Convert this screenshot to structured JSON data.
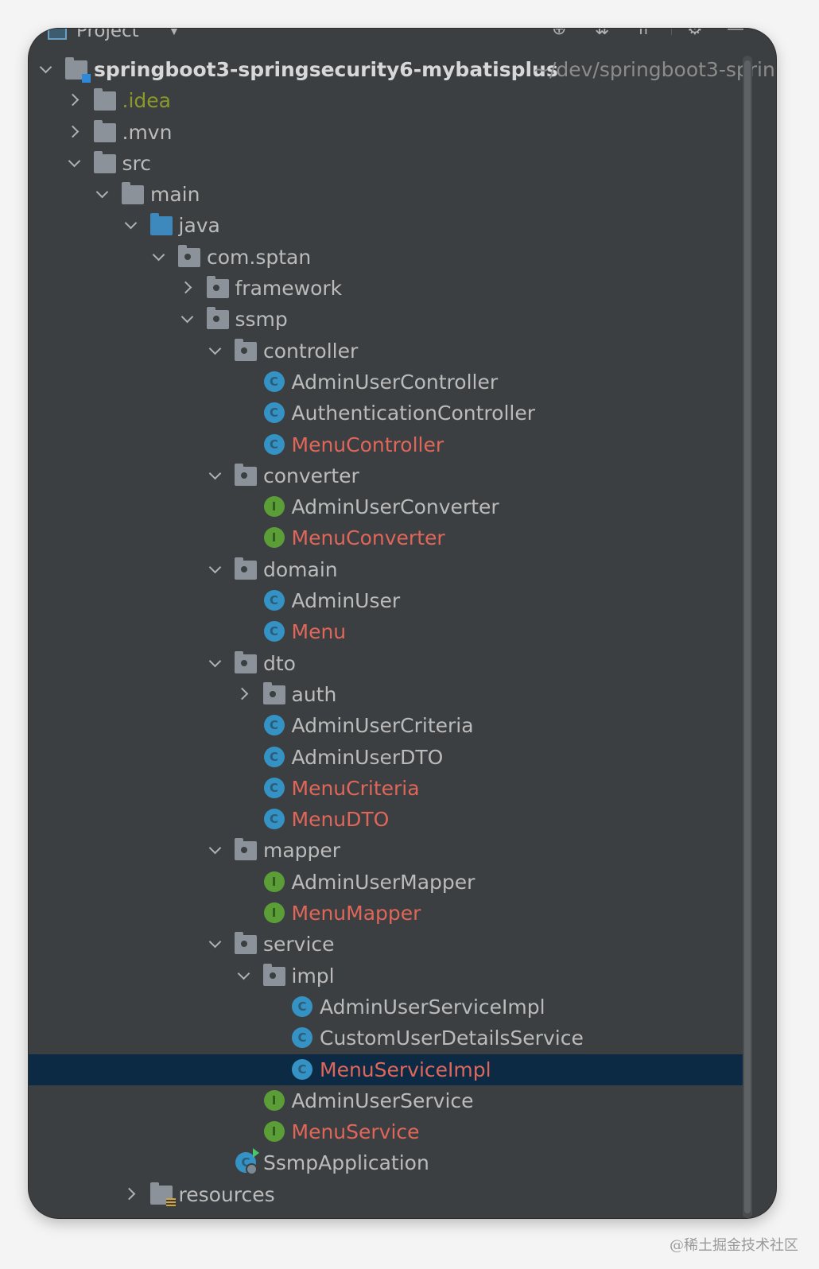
{
  "header": {
    "title": "Project",
    "caret_icon": "triangle-down-icon",
    "toolbar": [
      "crosshair-icon",
      "expand-all-icon",
      "collapse-all-icon",
      "gear-icon",
      "minimize-icon"
    ]
  },
  "tree": [
    {
      "depth": 0,
      "state": "expanded",
      "icon": "module-folder",
      "label": "springboot3-springsecurity6-mybatisplus",
      "path": "~/dev/springboot3-sprin",
      "style": "root"
    },
    {
      "depth": 1,
      "state": "collapsed",
      "icon": "folder",
      "label": ".idea",
      "style": "ignored"
    },
    {
      "depth": 1,
      "state": "collapsed",
      "icon": "folder",
      "label": ".mvn",
      "style": "normal"
    },
    {
      "depth": 1,
      "state": "expanded",
      "icon": "folder",
      "label": "src",
      "style": "normal"
    },
    {
      "depth": 2,
      "state": "expanded",
      "icon": "folder",
      "label": "main",
      "style": "normal"
    },
    {
      "depth": 3,
      "state": "expanded",
      "icon": "source-folder",
      "label": "java",
      "style": "normal"
    },
    {
      "depth": 4,
      "state": "expanded",
      "icon": "package",
      "label": "com.sptan",
      "style": "normal"
    },
    {
      "depth": 5,
      "state": "collapsed",
      "icon": "package",
      "label": "framework",
      "style": "normal"
    },
    {
      "depth": 5,
      "state": "expanded",
      "icon": "package",
      "label": "ssmp",
      "style": "normal"
    },
    {
      "depth": 6,
      "state": "expanded",
      "icon": "package",
      "label": "controller",
      "style": "normal"
    },
    {
      "depth": 7,
      "state": "leaf",
      "icon": "class",
      "label": "AdminUserController",
      "style": "normal"
    },
    {
      "depth": 7,
      "state": "leaf",
      "icon": "class",
      "label": "AuthenticationController",
      "style": "normal"
    },
    {
      "depth": 7,
      "state": "leaf",
      "icon": "class",
      "label": "MenuController",
      "style": "changed"
    },
    {
      "depth": 6,
      "state": "expanded",
      "icon": "package",
      "label": "converter",
      "style": "normal"
    },
    {
      "depth": 7,
      "state": "leaf",
      "icon": "interface",
      "label": "AdminUserConverter",
      "style": "normal"
    },
    {
      "depth": 7,
      "state": "leaf",
      "icon": "interface",
      "label": "MenuConverter",
      "style": "changed"
    },
    {
      "depth": 6,
      "state": "expanded",
      "icon": "package",
      "label": "domain",
      "style": "normal"
    },
    {
      "depth": 7,
      "state": "leaf",
      "icon": "class",
      "label": "AdminUser",
      "style": "normal"
    },
    {
      "depth": 7,
      "state": "leaf",
      "icon": "class",
      "label": "Menu",
      "style": "changed"
    },
    {
      "depth": 6,
      "state": "expanded",
      "icon": "package",
      "label": "dto",
      "style": "normal"
    },
    {
      "depth": 7,
      "state": "collapsed",
      "icon": "package",
      "label": "auth",
      "style": "normal"
    },
    {
      "depth": 7,
      "state": "leaf",
      "icon": "class",
      "label": "AdminUserCriteria",
      "style": "normal"
    },
    {
      "depth": 7,
      "state": "leaf",
      "icon": "class",
      "label": "AdminUserDTO",
      "style": "normal"
    },
    {
      "depth": 7,
      "state": "leaf",
      "icon": "class",
      "label": "MenuCriteria",
      "style": "changed"
    },
    {
      "depth": 7,
      "state": "leaf",
      "icon": "class",
      "label": "MenuDTO",
      "style": "changed"
    },
    {
      "depth": 6,
      "state": "expanded",
      "icon": "package",
      "label": "mapper",
      "style": "normal"
    },
    {
      "depth": 7,
      "state": "leaf",
      "icon": "interface",
      "label": "AdminUserMapper",
      "style": "normal"
    },
    {
      "depth": 7,
      "state": "leaf",
      "icon": "interface",
      "label": "MenuMapper",
      "style": "changed"
    },
    {
      "depth": 6,
      "state": "expanded",
      "icon": "package",
      "label": "service",
      "style": "normal"
    },
    {
      "depth": 7,
      "state": "expanded",
      "icon": "package",
      "label": "impl",
      "style": "normal"
    },
    {
      "depth": 8,
      "state": "leaf",
      "icon": "class",
      "label": "AdminUserServiceImpl",
      "style": "normal"
    },
    {
      "depth": 8,
      "state": "leaf",
      "icon": "class",
      "label": "CustomUserDetailsService",
      "style": "normal"
    },
    {
      "depth": 8,
      "state": "leaf",
      "icon": "class",
      "label": "MenuServiceImpl",
      "style": "changed",
      "selected": true
    },
    {
      "depth": 7,
      "state": "leaf",
      "icon": "interface",
      "label": "AdminUserService",
      "style": "normal"
    },
    {
      "depth": 7,
      "state": "leaf",
      "icon": "interface",
      "label": "MenuService",
      "style": "changed"
    },
    {
      "depth": 6,
      "state": "leaf",
      "icon": "spring-app",
      "label": "SsmpApplication",
      "style": "normal"
    },
    {
      "depth": 3,
      "state": "collapsed",
      "icon": "resources-folder",
      "label": "resources",
      "style": "normal"
    }
  ],
  "colors": {
    "background": "#3c3f41",
    "text": "#bbbbbb",
    "changed": "#e0665a",
    "ignored": "#8a9a2a",
    "selection": "#0d2a45",
    "class_icon": "#3592c4",
    "interface_icon": "#5b9e37"
  },
  "watermark": "@稀土掘金技术社区"
}
